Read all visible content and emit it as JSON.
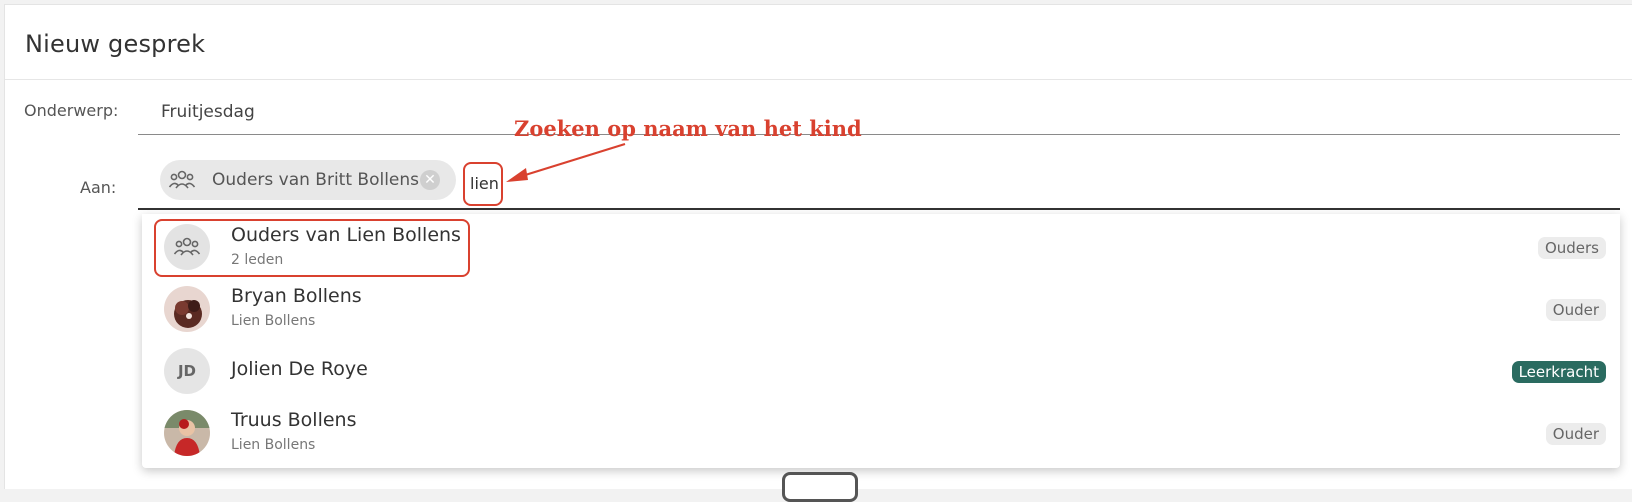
{
  "header": {
    "title": "Nieuw gesprek"
  },
  "form": {
    "subject_label": "Onderwerp:",
    "subject_value": "Fruitjesdag",
    "to_label": "Aan:"
  },
  "recipient_chip": {
    "label": "Ouders van Britt Bollens",
    "icon": "group-icon",
    "remove_icon": "close-icon"
  },
  "search": {
    "query": "lien"
  },
  "annotation": {
    "text": "Zoeken op naam van het kind",
    "color": "#d9412f"
  },
  "results": [
    {
      "name": "Ouders van Lien Bollens",
      "sub": "2 leden",
      "badge": "Ouders",
      "avatar": "group-icon"
    },
    {
      "name": "Bryan Bollens",
      "sub": "Lien Bollens",
      "badge": "Ouder",
      "avatar": "photo"
    },
    {
      "name": "Jolien De Roye",
      "sub": "",
      "badge": "Leerkracht",
      "avatar": "initials",
      "initials": "JD"
    },
    {
      "name": "Truus Bollens",
      "sub": "Lien Bollens",
      "badge": "Ouder",
      "avatar": "photo"
    }
  ],
  "colors": {
    "teacher_badge": "#2a6b60",
    "highlight": "#d9412f"
  }
}
